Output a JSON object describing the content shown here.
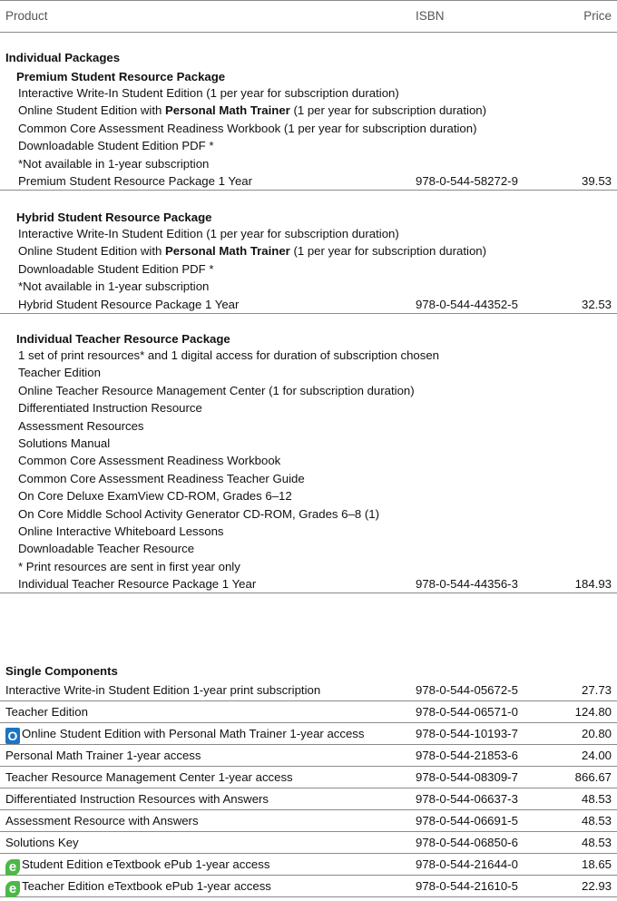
{
  "header": {
    "product": "Product",
    "isbn": "ISBN",
    "price": "Price"
  },
  "individual": {
    "title": "Individual Packages",
    "premium": {
      "title": "Premium Student Resource Package",
      "line1": "Interactive Write-In Student Edition (1 per year for subscription duration)",
      "line2_pre": "Online Student Edition with ",
      "line2_bold": "Personal Math Trainer",
      "line2_post": " (1 per year for subscription duration)",
      "line3": "Common Core Assessment Readiness Workbook (1 per year for subscription duration)",
      "line4": "Downloadable Student Edition PDF *",
      "line5": "*Not available in 1-year subscription",
      "item": {
        "name": "Premium Student Resource Package 1 Year",
        "isbn": "978-0-544-58272-9",
        "price": "39.53"
      }
    },
    "hybrid": {
      "title": "Hybrid Student Resource Package",
      "line1": "Interactive Write-In Student Edition (1 per year for subscription duration)",
      "line2_pre": "Online Student Edition with ",
      "line2_bold": "Personal Math Trainer",
      "line2_post": " (1 per year for subscription duration)",
      "line3": "Downloadable Student Edition PDF *",
      "line4": "*Not available in 1-year subscription",
      "item": {
        "name": "Hybrid Student Resource Package 1 Year",
        "isbn": "978-0-544-44352-5",
        "price": "32.53"
      }
    },
    "teacher": {
      "title": "Individual Teacher Resource Package",
      "lines": [
        "1 set of print resources* and 1 digital access for duration of subscription chosen",
        "Teacher Edition",
        "Online Teacher Resource Management Center (1 for subscription duration)",
        "Differentiated Instruction Resource",
        "Assessment Resources",
        "Solutions Manual",
        "Common Core Assessment Readiness Workbook",
        "Common Core Assessment Readiness Teacher Guide",
        "On Core Deluxe ExamView CD-ROM, Grades 6–12",
        "On Core Middle School Activity Generator CD-ROM, Grades 6–8 (1)",
        "Online Interactive Whiteboard Lessons",
        "Downloadable Teacher Resource",
        "* Print resources are sent in first year only"
      ],
      "item": {
        "name": "Individual Teacher Resource Package 1 Year",
        "isbn": "978-0-544-44356-3",
        "price": "184.93"
      }
    }
  },
  "single": {
    "title": "Single Components",
    "rows": [
      {
        "icon": "",
        "name": "Interactive Write-in Student Edition 1-year print subscription",
        "isbn": "978-0-544-05672-5",
        "price": "27.73"
      },
      {
        "icon": "",
        "name": "Teacher Edition",
        "isbn": "978-0-544-06571-0",
        "price": "124.80"
      },
      {
        "icon": "online-icon",
        "name": "Online Student Edition with Personal Math Trainer 1-year access",
        "isbn": "978-0-544-10193-7",
        "price": "20.80"
      },
      {
        "icon": "",
        "name": "Personal Math Trainer 1-year access",
        "isbn": "978-0-544-21853-6",
        "price": "24.00"
      },
      {
        "icon": "",
        "name": "Teacher Resource Management Center 1-year access",
        "isbn": "978-0-544-08309-7",
        "price": "866.67"
      },
      {
        "icon": "",
        "name": "Differentiated Instruction Resources with Answers",
        "isbn": "978-0-544-06637-3",
        "price": "48.53"
      },
      {
        "icon": "",
        "name": "Assessment Resource with Answers",
        "isbn": "978-0-544-06691-5",
        "price": "48.53"
      },
      {
        "icon": "",
        "name": "Solutions Key",
        "isbn": "978-0-544-06850-6",
        "price": "48.53"
      },
      {
        "icon": "etextbook-icon",
        "name": "Student Edition eTextbook ePub 1-year access",
        "isbn": "978-0-544-21644-0",
        "price": "18.65"
      },
      {
        "icon": "etextbook-icon",
        "name": "Teacher Edition eTextbook ePub 1-year access",
        "isbn": "978-0-544-21610-5",
        "price": "22.93"
      }
    ]
  }
}
